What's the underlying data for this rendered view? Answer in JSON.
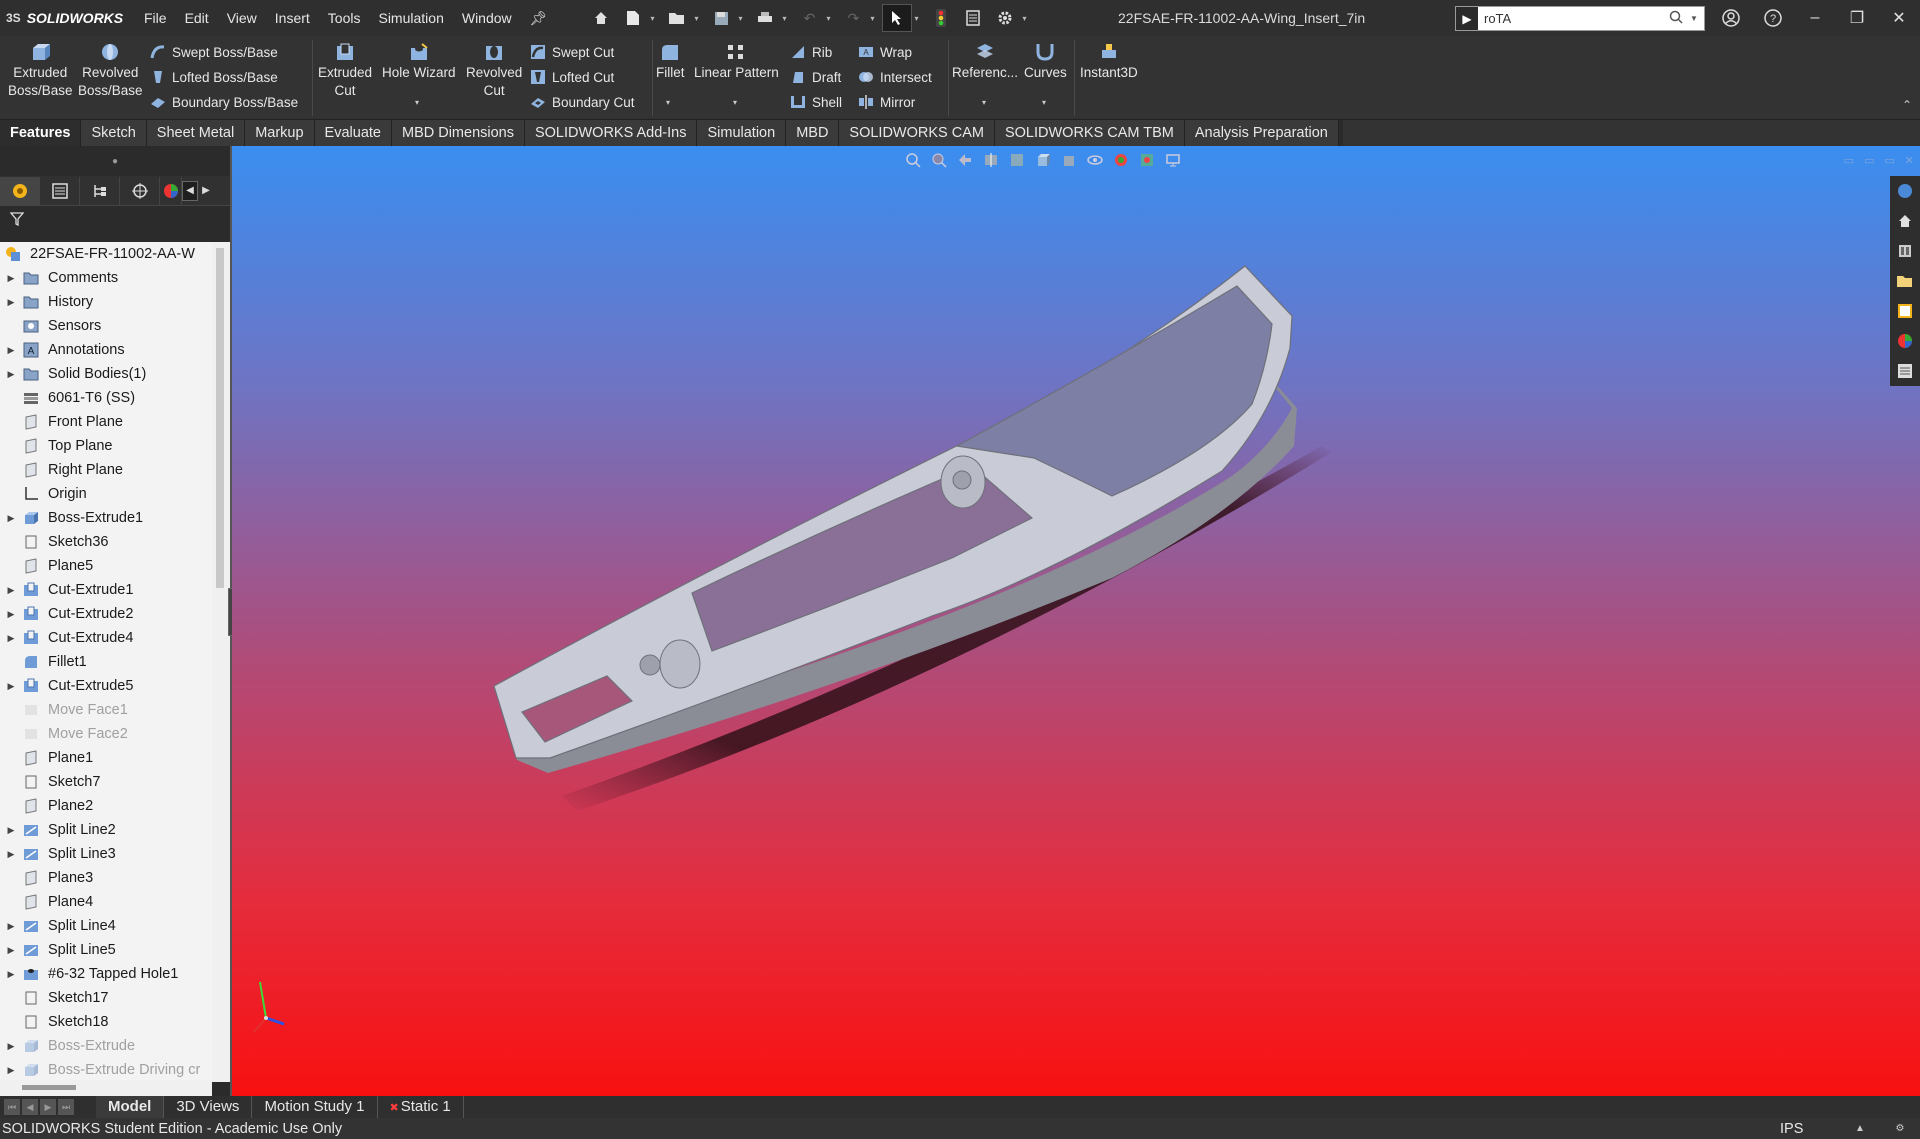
{
  "app": {
    "brand": "SOLIDWORKS",
    "brand_prefix": "3S"
  },
  "menu": [
    "File",
    "Edit",
    "View",
    "Insert",
    "Tools",
    "Simulation",
    "Window"
  ],
  "document_title": "22FSAE-FR-11002-AA-Wing_Insert_7in",
  "search": {
    "value": "roTA"
  },
  "ribbon": {
    "extruded_boss": [
      "Extruded",
      "Boss/Base"
    ],
    "revolved_boss": [
      "Revolved",
      "Boss/Base"
    ],
    "swept_boss": "Swept Boss/Base",
    "lofted_boss": "Lofted Boss/Base",
    "boundary_boss": "Boundary Boss/Base",
    "extruded_cut": [
      "Extruded",
      "Cut"
    ],
    "hole_wizard": "Hole Wizard",
    "revolved_cut": [
      "Revolved",
      "Cut"
    ],
    "swept_cut": "Swept Cut",
    "lofted_cut": "Lofted Cut",
    "boundary_cut": "Boundary Cut",
    "fillet": "Fillet",
    "linear_pattern": "Linear Pattern",
    "rib": "Rib",
    "draft": "Draft",
    "shell": "Shell",
    "wrap": "Wrap",
    "intersect": "Intersect",
    "mirror": "Mirror",
    "reference": "Referenc...",
    "curves": "Curves",
    "instant3d": "Instant3D"
  },
  "command_tabs": [
    "Features",
    "Sketch",
    "Sheet Metal",
    "Markup",
    "Evaluate",
    "MBD Dimensions",
    "SOLIDWORKS Add-Ins",
    "Simulation",
    "MBD",
    "SOLIDWORKS CAM",
    "SOLIDWORKS CAM TBM",
    "Analysis Preparation"
  ],
  "tree": {
    "root": "22FSAE-FR-11002-AA-W",
    "items": [
      {
        "label": "Comments",
        "icon": "folder-icon",
        "expandable": true,
        "dim": false
      },
      {
        "label": "History",
        "icon": "folder-icon",
        "expandable": true,
        "dim": false
      },
      {
        "label": "Sensors",
        "icon": "sensor-icon",
        "expandable": false,
        "dim": false
      },
      {
        "label": "Annotations",
        "icon": "annotation-icon",
        "expandable": true,
        "dim": false
      },
      {
        "label": "Solid Bodies(1)",
        "icon": "folder-icon",
        "expandable": true,
        "dim": false
      },
      {
        "label": "6061-T6 (SS)",
        "icon": "material-icon",
        "expandable": false,
        "dim": false
      },
      {
        "label": "Front Plane",
        "icon": "plane-icon",
        "expandable": false,
        "dim": false
      },
      {
        "label": "Top Plane",
        "icon": "plane-icon",
        "expandable": false,
        "dim": false
      },
      {
        "label": "Right Plane",
        "icon": "plane-icon",
        "expandable": false,
        "dim": false
      },
      {
        "label": "Origin",
        "icon": "origin-icon",
        "expandable": false,
        "dim": false
      },
      {
        "label": "Boss-Extrude1",
        "icon": "extrude-icon",
        "expandable": true,
        "dim": false
      },
      {
        "label": "Sketch36",
        "icon": "sketch-icon",
        "expandable": false,
        "dim": false
      },
      {
        "label": "Plane5",
        "icon": "plane-icon",
        "expandable": false,
        "dim": false
      },
      {
        "label": "Cut-Extrude1",
        "icon": "cut-icon",
        "expandable": true,
        "dim": false
      },
      {
        "label": "Cut-Extrude2",
        "icon": "cut-icon",
        "expandable": true,
        "dim": false
      },
      {
        "label": "Cut-Extrude4",
        "icon": "cut-icon",
        "expandable": true,
        "dim": false
      },
      {
        "label": "Fillet1",
        "icon": "fillet-icon",
        "expandable": false,
        "dim": false
      },
      {
        "label": "Cut-Extrude5",
        "icon": "cut-icon",
        "expandable": true,
        "dim": false
      },
      {
        "label": "Move Face1",
        "icon": "move-face-icon",
        "expandable": false,
        "dim": true
      },
      {
        "label": "Move Face2",
        "icon": "move-face-icon",
        "expandable": false,
        "dim": true
      },
      {
        "label": "Plane1",
        "icon": "plane-icon",
        "expandable": false,
        "dim": false
      },
      {
        "label": "Sketch7",
        "icon": "sketch-icon",
        "expandable": false,
        "dim": false
      },
      {
        "label": "Plane2",
        "icon": "plane-icon",
        "expandable": false,
        "dim": false
      },
      {
        "label": "Split Line2",
        "icon": "split-line-icon",
        "expandable": true,
        "dim": false
      },
      {
        "label": "Split Line3",
        "icon": "split-line-icon",
        "expandable": true,
        "dim": false
      },
      {
        "label": "Plane3",
        "icon": "plane-icon",
        "expandable": false,
        "dim": false
      },
      {
        "label": "Plane4",
        "icon": "plane-icon",
        "expandable": false,
        "dim": false
      },
      {
        "label": "Split Line4",
        "icon": "split-line-icon",
        "expandable": true,
        "dim": false
      },
      {
        "label": "Split Line5",
        "icon": "split-line-icon",
        "expandable": true,
        "dim": false
      },
      {
        "label": "#6-32 Tapped Hole1",
        "icon": "hole-icon",
        "expandable": true,
        "dim": false
      },
      {
        "label": "Sketch17",
        "icon": "sketch-icon",
        "expandable": false,
        "dim": false
      },
      {
        "label": "Sketch18",
        "icon": "sketch-icon",
        "expandable": false,
        "dim": false
      },
      {
        "label": "Boss-Extrude",
        "icon": "extrude-icon",
        "expandable": true,
        "dim": true
      },
      {
        "label": "Boss-Extrude Driving cr",
        "icon": "extrude-icon",
        "expandable": true,
        "dim": true
      }
    ]
  },
  "bottom_tabs": [
    {
      "label": "Model",
      "active": true,
      "error": false
    },
    {
      "label": "3D Views",
      "active": false,
      "error": false
    },
    {
      "label": "Motion Study 1",
      "active": false,
      "error": false
    },
    {
      "label": "Static 1",
      "active": false,
      "error": true
    }
  ],
  "status": {
    "text": "SOLIDWORKS Student Edition - Academic Use Only",
    "units": "IPS"
  },
  "colors": {
    "viewport_top": "#3a8ef0",
    "viewport_bottom": "#f81010",
    "part": "#c9cbd6"
  }
}
